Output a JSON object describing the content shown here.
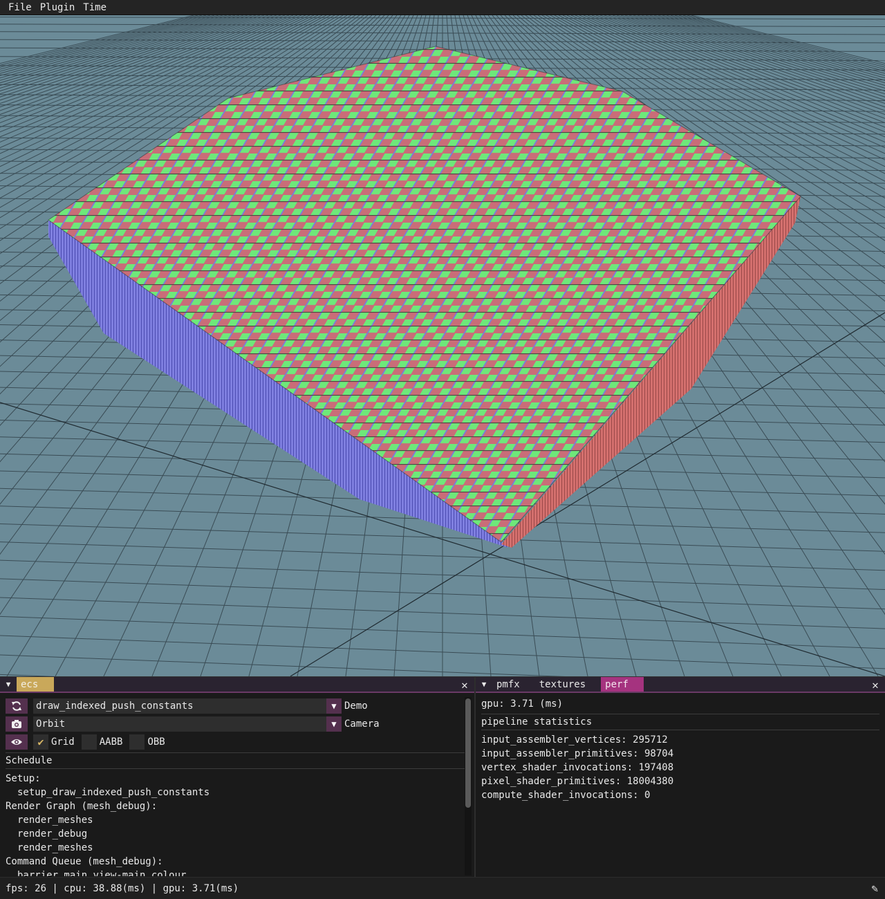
{
  "menubar": {
    "items": [
      "File",
      "Plugin",
      "Time"
    ]
  },
  "ecs_panel": {
    "tab_label": "ecs",
    "demo_select": {
      "value": "draw_indexed_push_constants",
      "label": "Demo"
    },
    "camera_select": {
      "value": "Orbit",
      "label": "Camera"
    },
    "toggles": [
      {
        "label": "Grid",
        "checked": true
      },
      {
        "label": "AABB",
        "checked": false
      },
      {
        "label": "OBB",
        "checked": false
      }
    ],
    "schedule_title": "Schedule",
    "schedule_lines": [
      {
        "text": "Setup:",
        "indent": 0
      },
      {
        "text": "setup_draw_indexed_push_constants",
        "indent": 1
      },
      {
        "text": "Render Graph (mesh_debug):",
        "indent": 0
      },
      {
        "text": "render_meshes",
        "indent": 1
      },
      {
        "text": "render_debug",
        "indent": 1
      },
      {
        "text": "render_meshes",
        "indent": 1
      },
      {
        "text": "Command Queue (mesh_debug):",
        "indent": 0
      },
      {
        "text": "barrier main view-main colour",
        "indent": 1
      }
    ]
  },
  "perf_panel": {
    "tabs": [
      "pmfx",
      "textures",
      "perf"
    ],
    "active_tab": "perf",
    "gpu_time": "gpu: 3.71 (ms)",
    "pipeline_title": "pipeline statistics",
    "stats": [
      "input_assembler_vertices: 295712",
      "input_assembler_primitives: 98704",
      "vertex_shader_invocations: 197408",
      "pixel_shader_primitives: 18004380",
      "compute_shader_invocations: 0"
    ]
  },
  "statusbar": {
    "text": "fps: 26 | cpu: 38.88(ms) | gpu: 3.71(ms)"
  },
  "colors": {
    "viewport_bg": "#6b8b98",
    "grid_line": "#3a4c55",
    "cube_top": "#7cf08a",
    "cube_side_red": "#d4706e",
    "cube_side_blue": "#7f7fe0",
    "tab_ecs": "#c9a85a",
    "tab_perf": "#a5337f",
    "button_bg": "#54304e"
  }
}
